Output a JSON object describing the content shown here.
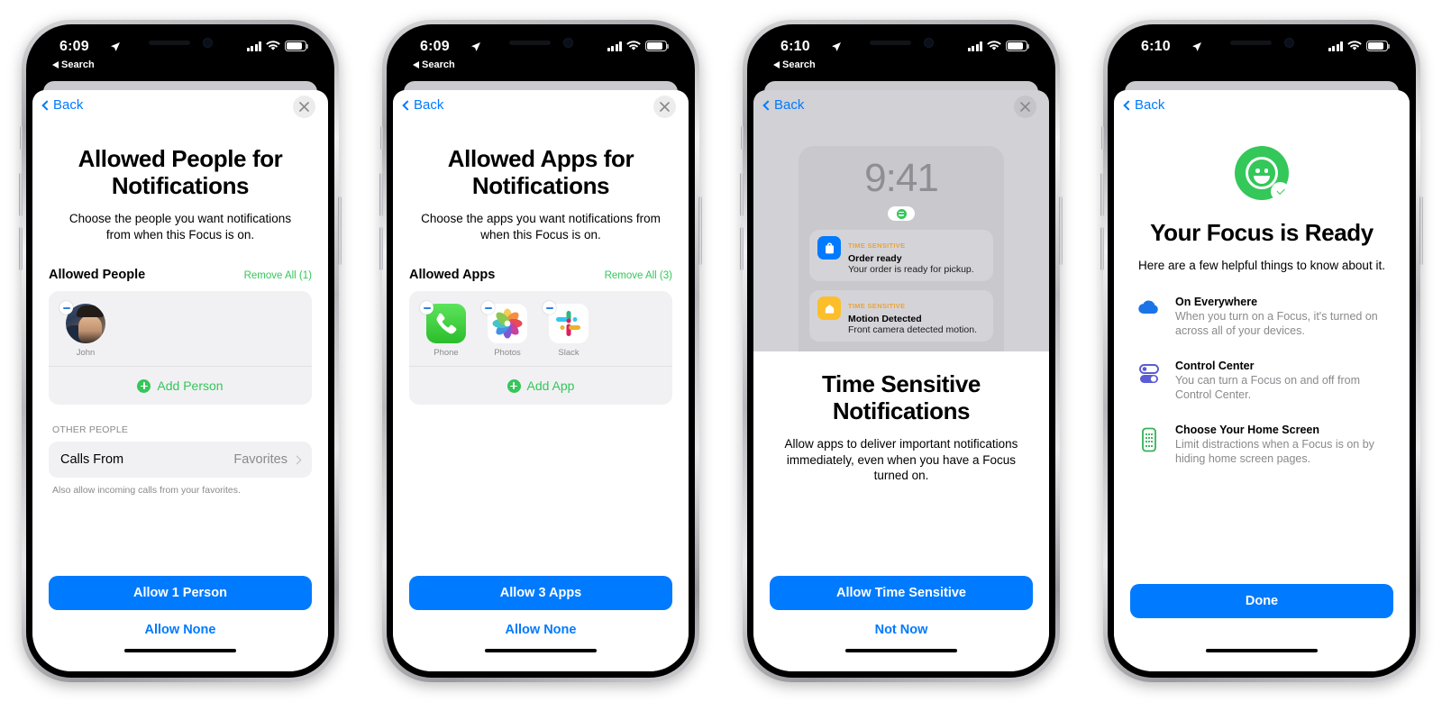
{
  "phones": [
    {
      "id": "allowed-people",
      "status": {
        "time": "6:09",
        "back_app": "Search",
        "location_icon": "location-arrow-icon"
      },
      "nav": {
        "back": "Back",
        "close_icon": "close-icon"
      },
      "title": "Allowed People for Notifications",
      "subtitle": "Choose the people you want notifications from when this Focus is on.",
      "section": {
        "label": "Allowed People",
        "action": "Remove All (1)"
      },
      "people": [
        {
          "name": "John",
          "avatar": "contact-photo"
        }
      ],
      "add_row": {
        "label": "Add Person",
        "icon": "plus-circle-icon"
      },
      "other_group": {
        "caption": "OTHER PEOPLE",
        "row_label": "Calls From",
        "row_value": "Favorites",
        "footnote": "Also allow incoming calls from your favorites."
      },
      "cta": "Allow 1 Person",
      "cta_sub": "Allow None"
    },
    {
      "id": "allowed-apps",
      "status": {
        "time": "6:09",
        "back_app": "Search",
        "location_icon": "location-arrow-icon"
      },
      "nav": {
        "back": "Back",
        "close_icon": "close-icon"
      },
      "title": "Allowed Apps for Notifications",
      "subtitle": "Choose the apps you want notifications from when this Focus is on.",
      "section": {
        "label": "Allowed Apps",
        "action": "Remove All (3)"
      },
      "apps": [
        {
          "name": "Phone",
          "icon": "phone-app-icon"
        },
        {
          "name": "Photos",
          "icon": "photos-app-icon"
        },
        {
          "name": "Slack",
          "icon": "slack-app-icon"
        }
      ],
      "add_row": {
        "label": "Add App",
        "icon": "plus-circle-icon"
      },
      "cta": "Allow 3 Apps",
      "cta_sub": "Allow None"
    },
    {
      "id": "time-sensitive",
      "status": {
        "time": "6:10",
        "back_app": "Search",
        "location_icon": "location-arrow-icon"
      },
      "nav": {
        "back": "Back",
        "close_icon": "close-icon"
      },
      "lock": {
        "time": "9:41",
        "focus_badge_icon": "focus-smiley-icon",
        "notifications": [
          {
            "tag": "TIME SENSITIVE",
            "title": "Order ready",
            "body": "Your order is ready for pickup.",
            "icon": "shopping-bag-icon",
            "icon_color": "#007aff"
          },
          {
            "tag": "TIME SENSITIVE",
            "title": "Motion Detected",
            "body": "Front camera detected motion.",
            "icon": "home-icon",
            "icon_color": "#fcbe2a"
          }
        ]
      },
      "title": "Time Sensitive Notifications",
      "subtitle": "Allow apps to deliver important notifications immediately, even when you have a Focus turned on.",
      "cta": "Allow Time Sensitive",
      "cta_sub": "Not Now"
    },
    {
      "id": "focus-ready",
      "status": {
        "time": "6:10",
        "back_app": "",
        "location_icon": "location-arrow-icon"
      },
      "nav": {
        "back": "Back",
        "close_icon": ""
      },
      "hero_icon": "focus-smiley-check-icon",
      "title": "Your Focus is Ready",
      "subtitle": "Here are a few helpful things to know about it.",
      "features": [
        {
          "icon": "cloud-icon",
          "heading": "On Everywhere",
          "body": "When you turn on a Focus, it's turned on across all of your devices."
        },
        {
          "icon": "toggles-icon",
          "heading": "Control Center",
          "body": "You can turn a Focus on and off from Control Center."
        },
        {
          "icon": "home-screen-icon",
          "heading": "Choose Your Home Screen",
          "body": "Limit distractions when a Focus is on by hiding home screen pages."
        }
      ],
      "cta": "Done"
    }
  ],
  "colors": {
    "accent": "#007aff",
    "green": "#34c759",
    "orange": "#e8a33d"
  }
}
